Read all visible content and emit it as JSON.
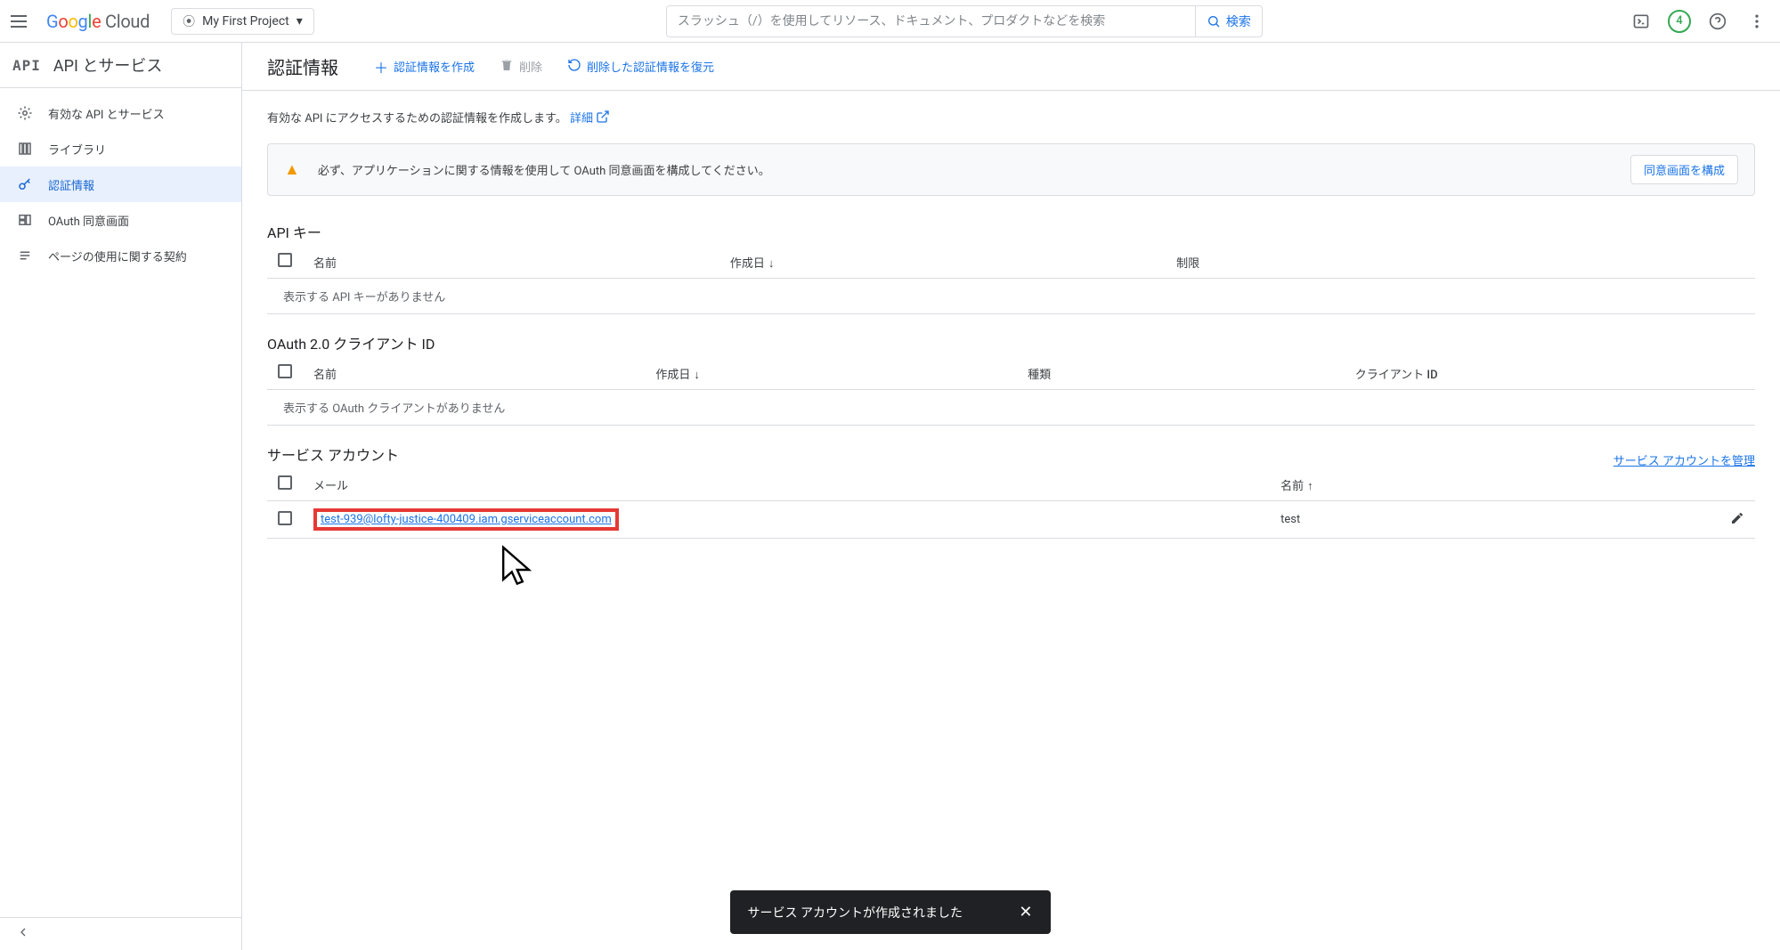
{
  "topbar": {
    "logo_cloud": "Cloud",
    "project_name": "My First Project",
    "search_placeholder": "スラッシュ（/）を使用してリソース、ドキュメント、プロダクトなどを検索",
    "search_button": "検索",
    "badge_count": "4"
  },
  "sidebar": {
    "title": "API とサービス",
    "items": [
      {
        "label": "有効な API とサービス"
      },
      {
        "label": "ライブラリ"
      },
      {
        "label": "認証情報"
      },
      {
        "label": "OAuth 同意画面"
      },
      {
        "label": "ページの使用に関する契約"
      }
    ]
  },
  "header": {
    "page_title": "認証情報",
    "create": "認証情報を作成",
    "delete": "削除",
    "restore": "削除した認証情報を復元"
  },
  "help": {
    "text": "有効な API にアクセスするための認証情報を作成します。",
    "link": "詳細"
  },
  "warning": {
    "text": "必ず、アプリケーションに関する情報を使用して OAuth 同意画面を構成してください。",
    "button": "同意画面を構成"
  },
  "api_keys": {
    "title": "API キー",
    "col_name": "名前",
    "col_created": "作成日",
    "col_restrict": "制限",
    "empty": "表示する API キーがありません"
  },
  "oauth_clients": {
    "title": "OAuth 2.0 クライアント ID",
    "col_name": "名前",
    "col_created": "作成日",
    "col_type": "種類",
    "col_clientid": "クライアント ID",
    "empty": "表示する OAuth クライアントがありません"
  },
  "service_accounts": {
    "title": "サービス アカウント",
    "manage": "サービス アカウントを管理",
    "col_email": "メール",
    "col_name": "名前",
    "row": {
      "email": "test-939@lofty-justice-400409.iam.gserviceaccount.com",
      "name": "test"
    }
  },
  "toast": {
    "message": "サービス アカウントが作成されました"
  }
}
